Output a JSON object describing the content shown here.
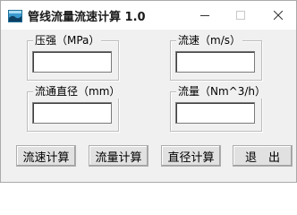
{
  "window": {
    "title": "管线流量流速计算 1.0",
    "controls": {
      "minimize": "—",
      "maximize": "☐",
      "close": "✕"
    }
  },
  "groups": {
    "pressure": {
      "label": "压强（MPa）",
      "value": ""
    },
    "velocity": {
      "label": "流速（m/s）",
      "value": ""
    },
    "diameter": {
      "label": "流通直径（mm）",
      "value": ""
    },
    "flow": {
      "label": "流量（Nm^3/h）",
      "value": ""
    }
  },
  "buttons": {
    "calc_velocity": "流速计算",
    "calc_flow": "流量计算",
    "calc_diameter": "直径计算",
    "exit": "退　出"
  }
}
